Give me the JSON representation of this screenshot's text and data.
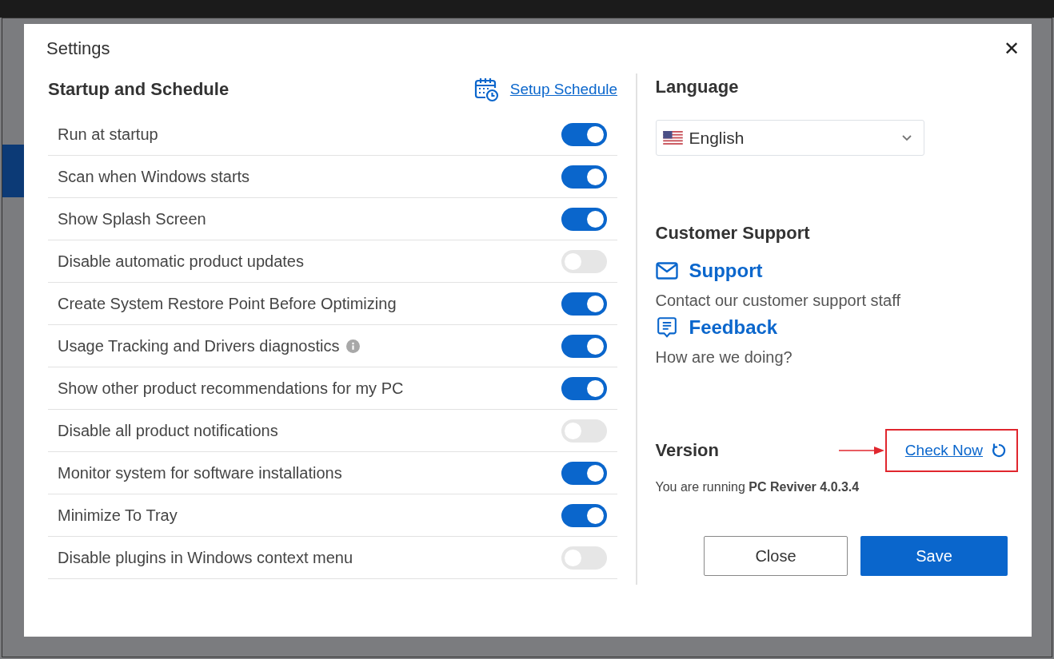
{
  "dialog": {
    "title": "Settings",
    "close": "✕"
  },
  "startup": {
    "title": "Startup and Schedule",
    "schedule_link": "Setup Schedule",
    "options": [
      {
        "label": "Run at startup",
        "on": true,
        "info": false
      },
      {
        "label": "Scan when Windows starts",
        "on": true,
        "info": false
      },
      {
        "label": "Show Splash Screen",
        "on": true,
        "info": false
      },
      {
        "label": "Disable automatic product updates",
        "on": false,
        "info": false
      },
      {
        "label": "Create System Restore Point Before Optimizing",
        "on": true,
        "info": false
      },
      {
        "label": "Usage Tracking and Drivers diagnostics",
        "on": true,
        "info": true
      },
      {
        "label": "Show other product recommendations for my PC",
        "on": true,
        "info": false
      },
      {
        "label": "Disable all product notifications",
        "on": false,
        "info": false
      },
      {
        "label": "Monitor system for software installations",
        "on": true,
        "info": false
      },
      {
        "label": "Minimize To Tray",
        "on": true,
        "info": false
      },
      {
        "label": "Disable plugins in Windows context menu",
        "on": false,
        "info": false
      }
    ]
  },
  "language": {
    "title": "Language",
    "value": "English"
  },
  "support": {
    "title": "Customer Support",
    "links": [
      {
        "kind": "mail",
        "label": "Support",
        "description": "Contact our customer support staff"
      },
      {
        "kind": "chat",
        "label": "Feedback",
        "description": "How are we doing?"
      }
    ]
  },
  "version": {
    "title": "Version",
    "check_link": "Check Now",
    "text": "You are running **PC Reviver 4.0.3.4**"
  },
  "buttons": [
    {
      "label": "Close",
      "primary": false
    },
    {
      "label": "Save",
      "primary": true
    }
  ]
}
